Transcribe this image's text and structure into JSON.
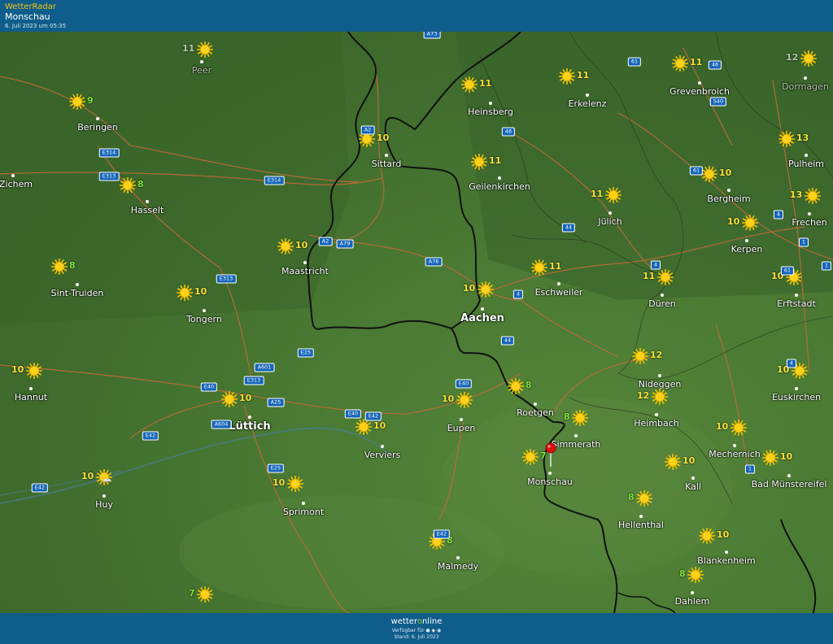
{
  "header": {
    "brand": "WetterRadar",
    "location": "Monschau",
    "timestamp": "6. Juli 2023 um 05:35"
  },
  "footer": {
    "logo_a": "wetter",
    "logo_b": "o",
    "logo_c": "nline",
    "available": "Verfügbar für ● ◆ ◉",
    "stand": "Stand: 6. Juli 2023"
  },
  "colors": {
    "header_bg": "#0f5d8a",
    "temp_yellow": "#f6e23a",
    "temp_green": "#7ee23a",
    "border": "#111111",
    "road": "#c06b3a"
  },
  "cities": [
    {
      "name": "Peer",
      "temp": "11",
      "color": "faded",
      "icon": "sun-icon"
    },
    {
      "name": "Beringen",
      "temp": "9",
      "color": "green",
      "icon": "sun-icon"
    },
    {
      "name": "l-Zichem",
      "temp": "",
      "color": "",
      "icon": ""
    },
    {
      "name": "Hasselt",
      "temp": "8",
      "color": "green",
      "icon": "sun-icon"
    },
    {
      "name": "Sint-Truiden",
      "temp": "8",
      "color": "green",
      "icon": "sun-icon"
    },
    {
      "name": "Tongern",
      "temp": "10",
      "color": "yellow",
      "icon": "sun-icon"
    },
    {
      "name": "Hannut",
      "temp": "10",
      "color": "yellow",
      "icon": "sun-icon"
    },
    {
      "name": "Lüttich",
      "temp": "10",
      "color": "yellow",
      "icon": "sun-icon"
    },
    {
      "name": "Huy",
      "temp": "10",
      "color": "yellow",
      "icon": "sun-partly-icon"
    },
    {
      "name": "Sprimont",
      "temp": "10",
      "color": "yellow",
      "icon": "sun-icon"
    },
    {
      "name": "Verviers",
      "temp": "10",
      "color": "yellow",
      "icon": "sun-icon"
    },
    {
      "name": "Malmedy",
      "temp": "8",
      "color": "green",
      "icon": "sun-icon"
    },
    {
      "name": "Eupen",
      "temp": "10",
      "color": "yellow",
      "icon": "sun-icon"
    },
    {
      "name": "Maastricht",
      "temp": "10",
      "color": "yellow",
      "icon": "sun-icon"
    },
    {
      "name": "Sittard",
      "temp": "10",
      "color": "yellow",
      "icon": "sun-icon"
    },
    {
      "name": "Heinsberg",
      "temp": "11",
      "color": "yellow",
      "icon": "sun-icon"
    },
    {
      "name": "Geilenkirchen",
      "temp": "11",
      "color": "yellow",
      "icon": "sun-icon"
    },
    {
      "name": "Erkelenz",
      "temp": "11",
      "color": "yellow",
      "icon": "sun-icon"
    },
    {
      "name": "Grevenbroich",
      "temp": "11",
      "color": "yellow",
      "icon": "sun-icon"
    },
    {
      "name": "Dormagen",
      "temp": "12",
      "color": "faded",
      "icon": "sun-icon"
    },
    {
      "name": "Pulheim",
      "temp": "13",
      "color": "yellow",
      "icon": "sun-icon"
    },
    {
      "name": "Bergheim",
      "temp": "10",
      "color": "yellow",
      "icon": "sun-icon"
    },
    {
      "name": "Frechen",
      "temp": "13",
      "color": "yellow",
      "icon": "sun-icon"
    },
    {
      "name": "Kerpen",
      "temp": "10",
      "color": "yellow",
      "icon": "sun-icon"
    },
    {
      "name": "Jülich",
      "temp": "11",
      "color": "yellow",
      "icon": "sun-icon"
    },
    {
      "name": "Eschweiler",
      "temp": "11",
      "color": "yellow",
      "icon": "sun-icon"
    },
    {
      "name": "Aachen",
      "temp": "10",
      "color": "yellow",
      "icon": "sun-icon"
    },
    {
      "name": "Düren",
      "temp": "11",
      "color": "yellow",
      "icon": "sun-icon"
    },
    {
      "name": "Erftstadt",
      "temp": "10",
      "color": "yellow",
      "icon": "sun-icon"
    },
    {
      "name": "Nideggen",
      "temp": "12",
      "color": "yellow",
      "icon": "sun-icon"
    },
    {
      "name": "Heimbach",
      "temp": "12",
      "color": "yellow",
      "icon": "sun-icon"
    },
    {
      "name": "Euskirchen",
      "temp": "10",
      "color": "yellow",
      "icon": "sun-icon"
    },
    {
      "name": "Roetgen",
      "temp": "8",
      "color": "green",
      "icon": "sun-icon"
    },
    {
      "name": "Simmerath",
      "temp": "8",
      "color": "green",
      "icon": "sun-icon"
    },
    {
      "name": "Monschau",
      "temp": "7",
      "color": "green",
      "icon": "sun-icon"
    },
    {
      "name": "Mechernich",
      "temp": "10",
      "color": "yellow",
      "icon": "sun-icon"
    },
    {
      "name": "Kall",
      "temp": "10",
      "color": "yellow",
      "icon": "sun-icon"
    },
    {
      "name": "Bad Münstereifel",
      "temp": "10",
      "color": "yellow",
      "icon": "sun-icon"
    },
    {
      "name": "Hellenthal",
      "temp": "8",
      "color": "green",
      "icon": "sun-icon"
    },
    {
      "name": "Blankenheim",
      "temp": "10",
      "color": "yellow",
      "icon": "sun-icon"
    },
    {
      "name": "Dahlem",
      "temp": "8",
      "color": "green",
      "icon": "sun-icon"
    },
    {
      "name": "",
      "temp": "7",
      "color": "green",
      "icon": "sun-icon"
    }
  ],
  "roads": [
    "A73",
    "A2",
    "E314",
    "E313",
    "E314",
    "A2",
    "A79",
    "A76",
    "E313",
    "E25",
    "A601",
    "E313",
    "E40",
    "A25",
    "A604",
    "E42",
    "E40",
    "E42",
    "E40",
    "E25",
    "E42",
    "E42",
    "4",
    "44",
    "4",
    "44",
    "46",
    "61",
    "46",
    "S40",
    "61",
    "4",
    "1",
    "61",
    "4",
    "1",
    "1"
  ],
  "marker": {
    "label": "Monschau",
    "icon": "location-pin-icon"
  }
}
